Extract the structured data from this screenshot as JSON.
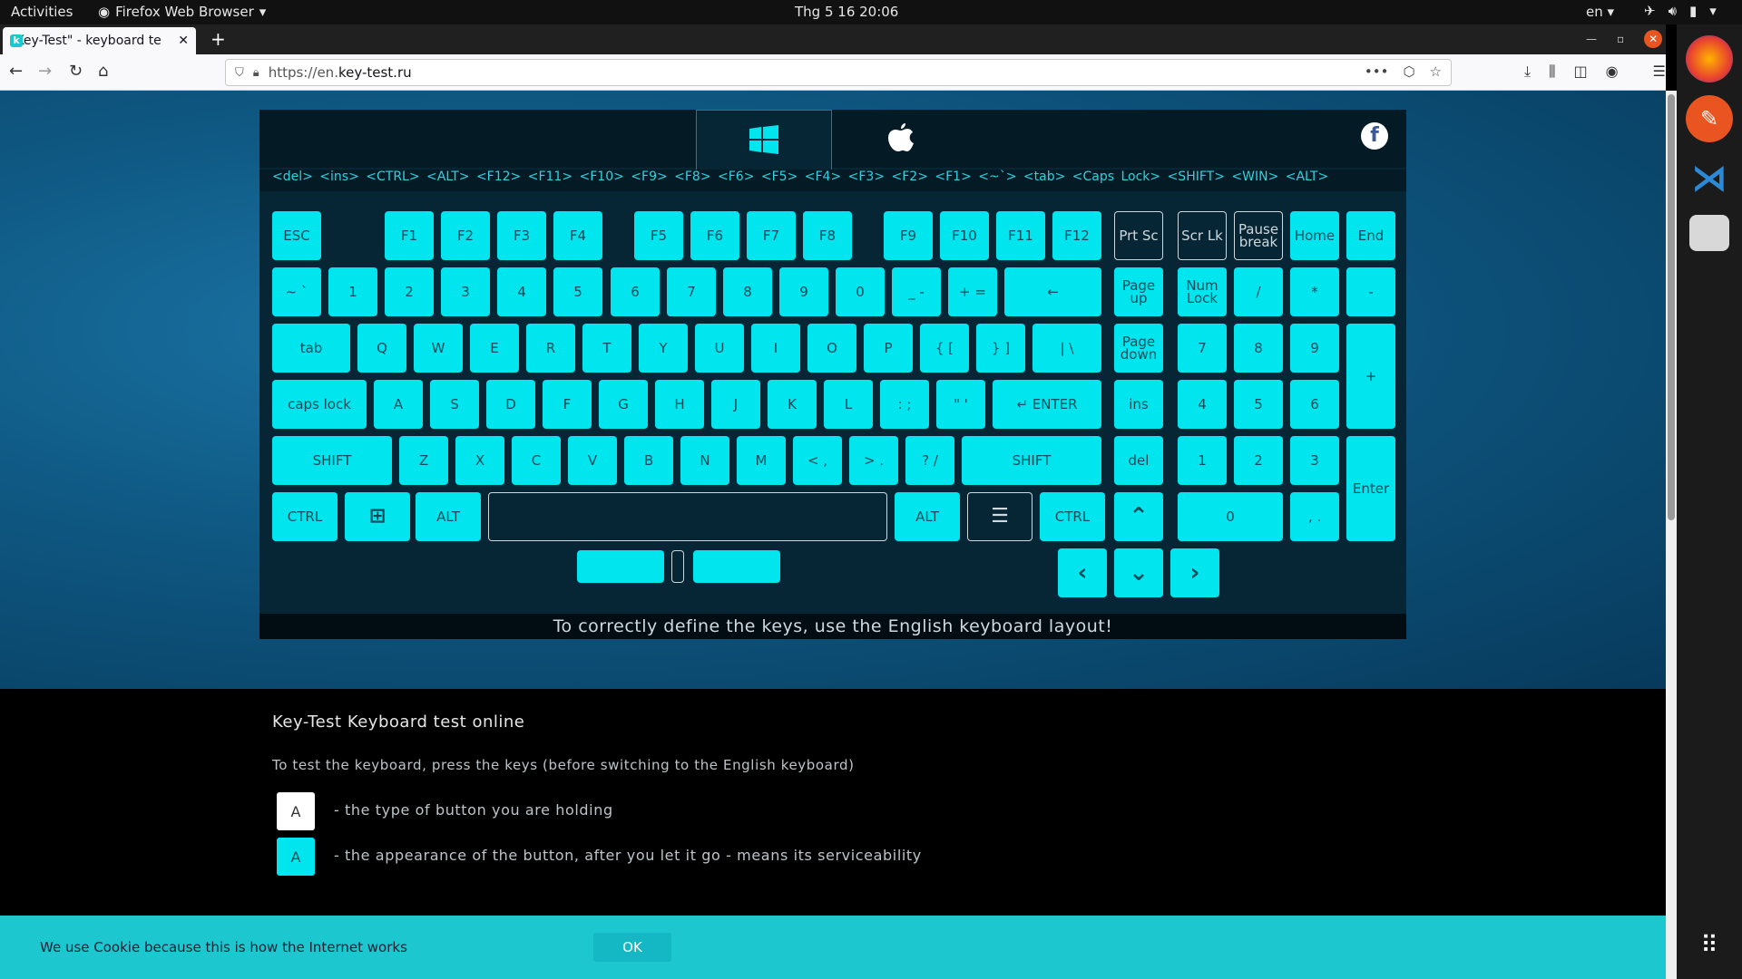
{
  "topbar": {
    "activities": "Activities",
    "app": "Firefox Web Browser",
    "clock": "Thg 5 16  20:06",
    "lang": "en"
  },
  "browser": {
    "tab_title": "\"Key-Test\" - keyboard te",
    "url_prefix": "https://en.",
    "url_domain": "key-test.ru",
    "url_suffix": ""
  },
  "keyboard": {
    "history": "<del> <ins> <CTRL> <ALT> <F12> <F11> <F10> <F9> <F8> <F6> <F5> <F4> <F3> <F2> <F1> <~`> <tab> <Caps Lock> <SHIFT> <WIN> <ALT>",
    "notice": "To correctly define the keys, use the English keyboard layout!",
    "keys": {
      "esc": "ESC",
      "f1": "F1",
      "f2": "F2",
      "f3": "F3",
      "f4": "F4",
      "f5": "F5",
      "f6": "F6",
      "f7": "F7",
      "f8": "F8",
      "f9": "F9",
      "f10": "F10",
      "f11": "F11",
      "f12": "F12",
      "prtsc": "Prt Sc",
      "scrlk": "Scr Lk",
      "pause": "Pause break",
      "home": "Home",
      "end": "End",
      "tilde": "~ `",
      "n1": "1",
      "n2": "2",
      "n3": "3",
      "n4": "4",
      "n5": "5",
      "n6": "6",
      "n7": "7",
      "n8": "8",
      "n9": "9",
      "n0": "0",
      "minus": "_ -",
      "plus": "+ =",
      "backspace": "←",
      "pgup": "Page up",
      "numlock": "Num Lock",
      "kpdiv": "/",
      "kpmul": "*",
      "kpminus": "-",
      "tab": "tab",
      "q": "Q",
      "w": "W",
      "e": "E",
      "r": "R",
      "t": "T",
      "y": "Y",
      "u": "U",
      "i": "I",
      "o": "O",
      "p": "P",
      "lbr": "{ [",
      "rbr": "} ]",
      "bslash": "| \\",
      "pgdn": "Page down",
      "kp7": "7",
      "kp8": "8",
      "kp9": "9",
      "kpplus": "+",
      "caps": "caps lock",
      "a": "A",
      "s": "S",
      "d": "D",
      "f": "F",
      "g": "G",
      "h": "H",
      "j": "J",
      "k": "K",
      "l": "L",
      "semi": ": ;",
      "quote": "\" '",
      "enter": "↵ ENTER",
      "ins": "ins",
      "kp4": "4",
      "kp5": "5",
      "kp6": "6",
      "lshift": "SHIFT",
      "z": "Z",
      "x": "X",
      "c": "C",
      "v": "V",
      "b": "B",
      "n": "N",
      "m": "M",
      "comma": "< ,",
      "period": "> .",
      "slash": "? /",
      "rshift": "SHIFT",
      "del": "del",
      "kp1": "1",
      "kp2": "2",
      "kp3": "3",
      "kpenter": "Enter",
      "lctrl": "CTRL",
      "lalt": "ALT",
      "ralt": "ALT",
      "rctrl": "CTRL",
      "kp0": "0",
      "kpdot": ", ."
    }
  },
  "info": {
    "heading": "Key-Test Keyboard test online",
    "para": "To test the keyboard, press the keys (before switching to the English keyboard)",
    "legend1_key": "A",
    "legend1_text": "- the type of button you are holding",
    "legend2_key": "A",
    "legend2_text": "- the appearance of the button, after you let it go - means its serviceability"
  },
  "cookie": {
    "text": "We use Cookie because this is how the Internet works",
    "ok": "OK"
  },
  "colors": {
    "key": "#00e5ee",
    "board": "#062535"
  }
}
